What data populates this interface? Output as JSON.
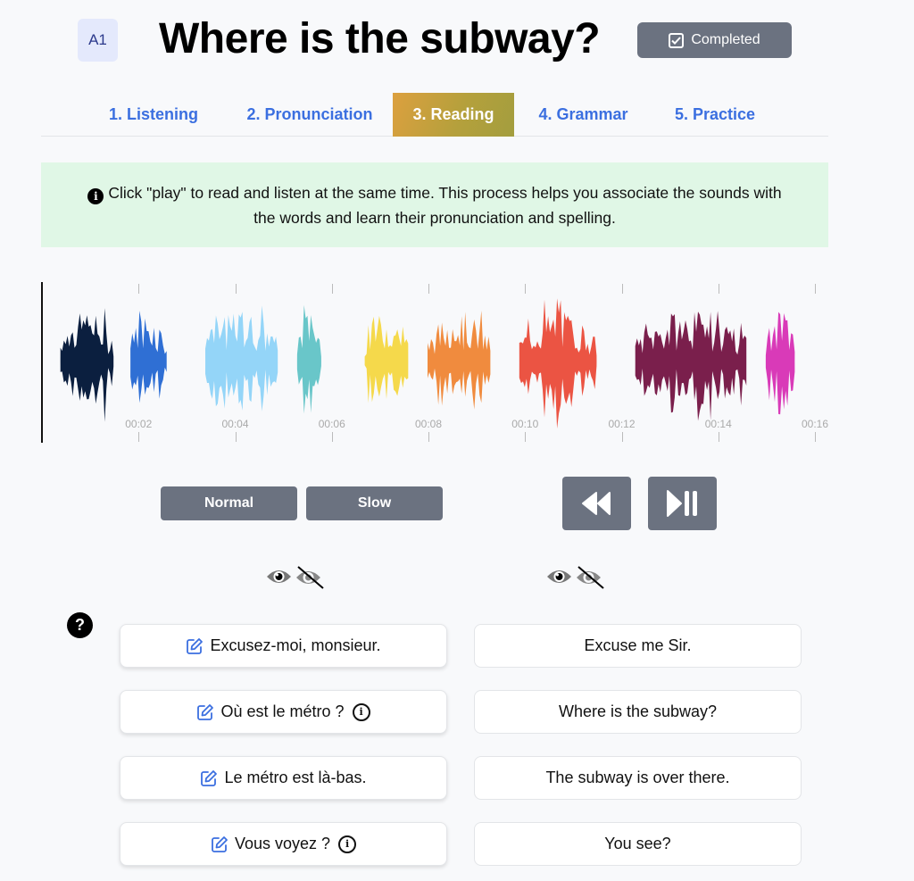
{
  "header": {
    "level": "A1",
    "title": "Where is the subway?",
    "completed_label": "Completed"
  },
  "tabs": [
    {
      "label": "1. Listening",
      "active": false
    },
    {
      "label": "2. Pronunciation",
      "active": false
    },
    {
      "label": "3. Reading",
      "active": true
    },
    {
      "label": "4. Grammar",
      "active": false
    },
    {
      "label": "5. Practice",
      "active": false
    }
  ],
  "info": {
    "text": "Click \"play\" to read and listen at the same time. This process helps you associate the sounds with the words and learn their pronunciation and spelling."
  },
  "waveform": {
    "duration_seconds": 16,
    "time_labels": [
      "00:02",
      "00:04",
      "00:06",
      "00:08",
      "00:10",
      "00:12",
      "00:14",
      "00:16"
    ],
    "segments": [
      {
        "color": "#0b1f3f",
        "start": 0.4,
        "end": 1.5
      },
      {
        "color": "#2f6fd4",
        "start": 1.85,
        "end": 2.6
      },
      {
        "color": "#94d5f8",
        "start": 3.4,
        "end": 4.9
      },
      {
        "color": "#69c6c9",
        "start": 5.3,
        "end": 5.8
      },
      {
        "color": "#f5d94b",
        "start": 6.7,
        "end": 7.6
      },
      {
        "color": "#f08b3e",
        "start": 8.0,
        "end": 9.3
      },
      {
        "color": "#eb5443",
        "start": 9.9,
        "end": 11.5
      },
      {
        "color": "#7a1f4c",
        "start": 12.3,
        "end": 14.6
      },
      {
        "color": "#d93ab8",
        "start": 15.0,
        "end": 15.6
      }
    ]
  },
  "controls": {
    "normal_label": "Normal",
    "slow_label": "Slow"
  },
  "sentences": [
    {
      "fr": "Excusez-moi, monsieur.",
      "en": "Excuse me Sir.",
      "has_info": false
    },
    {
      "fr": "Où est le métro ?",
      "en": "Where is the subway?",
      "has_info": true
    },
    {
      "fr": "Le métro est là-bas.",
      "en": "The subway is over there.",
      "has_info": false
    },
    {
      "fr": "Vous voyez ?",
      "en": "You see?",
      "has_info": true
    }
  ],
  "icons": {
    "help": "?",
    "info": "i"
  }
}
